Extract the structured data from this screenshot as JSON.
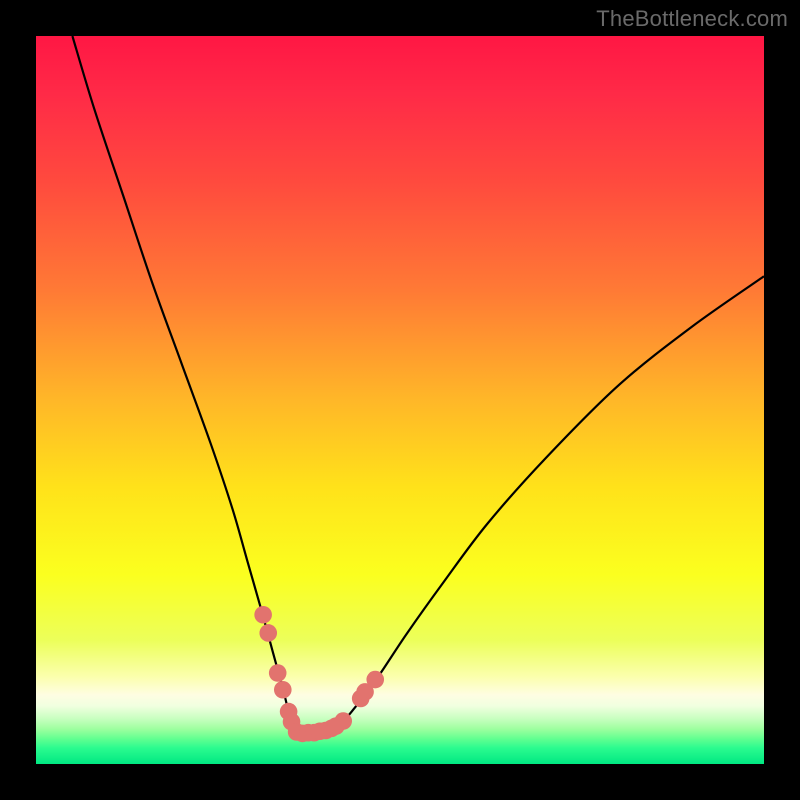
{
  "watermark": "TheBottleneck.com",
  "colors": {
    "black": "#000000",
    "curve": "#000000",
    "marker_fill": "#e2736e",
    "marker_stroke": "#de6762",
    "gradient_stops": [
      {
        "offset": 0.0,
        "color": "#ff1744"
      },
      {
        "offset": 0.08,
        "color": "#ff2a47"
      },
      {
        "offset": 0.2,
        "color": "#ff4a3e"
      },
      {
        "offset": 0.35,
        "color": "#ff7a35"
      },
      {
        "offset": 0.5,
        "color": "#ffb728"
      },
      {
        "offset": 0.62,
        "color": "#ffe21a"
      },
      {
        "offset": 0.74,
        "color": "#fbff1f"
      },
      {
        "offset": 0.83,
        "color": "#ecff5a"
      },
      {
        "offset": 0.88,
        "color": "#fbffad"
      },
      {
        "offset": 0.905,
        "color": "#fefde2"
      },
      {
        "offset": 0.92,
        "color": "#f1ffe0"
      },
      {
        "offset": 0.938,
        "color": "#c7ffbf"
      },
      {
        "offset": 0.952,
        "color": "#9dff9f"
      },
      {
        "offset": 0.965,
        "color": "#63ff91"
      },
      {
        "offset": 0.978,
        "color": "#2bfb8f"
      },
      {
        "offset": 1.0,
        "color": "#00e882"
      }
    ]
  },
  "chart_data": {
    "type": "line",
    "title": "",
    "xlabel": "",
    "ylabel": "",
    "xlim": [
      0,
      100
    ],
    "ylim": [
      0,
      100
    ],
    "series": [
      {
        "name": "bottleneck-curve",
        "x": [
          5,
          8,
          12,
          16,
          20,
          24,
          27,
          29,
          31,
          32.5,
          34,
          35,
          35.8,
          36.6,
          38,
          40,
          42,
          44,
          47,
          51,
          56,
          62,
          70,
          80,
          90,
          100
        ],
        "y": [
          100,
          90,
          78,
          66,
          55,
          44,
          35,
          28,
          21,
          15.5,
          10,
          6,
          4.3,
          4.2,
          4.3,
          4.7,
          5.7,
          8,
          12,
          18,
          25,
          33,
          42,
          52,
          60,
          67
        ]
      }
    ],
    "markers": {
      "name": "highlighted-points",
      "points": [
        {
          "x": 31.2,
          "y": 20.5
        },
        {
          "x": 31.9,
          "y": 18.0
        },
        {
          "x": 33.2,
          "y": 12.5
        },
        {
          "x": 33.9,
          "y": 10.2
        },
        {
          "x": 34.7,
          "y": 7.2
        },
        {
          "x": 35.1,
          "y": 5.8
        },
        {
          "x": 35.8,
          "y": 4.4
        },
        {
          "x": 36.6,
          "y": 4.2
        },
        {
          "x": 37.4,
          "y": 4.3
        },
        {
          "x": 38.2,
          "y": 4.3
        },
        {
          "x": 39.0,
          "y": 4.5
        },
        {
          "x": 39.8,
          "y": 4.6
        },
        {
          "x": 40.6,
          "y": 4.9
        },
        {
          "x": 41.2,
          "y": 5.2
        },
        {
          "x": 42.2,
          "y": 5.9
        },
        {
          "x": 44.6,
          "y": 9.0
        },
        {
          "x": 45.2,
          "y": 9.9
        },
        {
          "x": 46.6,
          "y": 11.6
        }
      ]
    }
  }
}
